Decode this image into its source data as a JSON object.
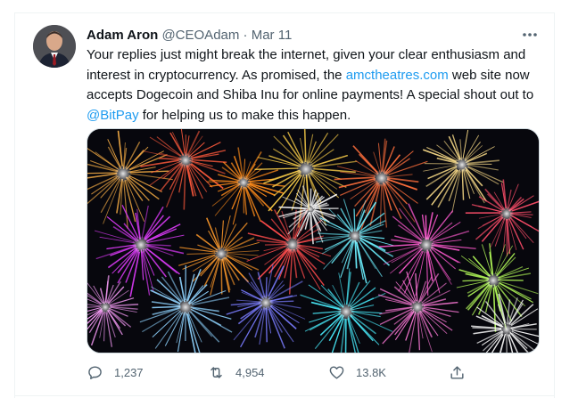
{
  "tweet": {
    "author_name": "Adam Aron",
    "handle": "@CEOAdam",
    "separator": "·",
    "date": "Mar 11",
    "text_part1": "Your replies just might break the internet, given your clear enthusiasm and interest in cryptocurrency. As promised, the ",
    "link_site": "amctheatres.com",
    "text_part2": " web site now accepts Dogecoin and Shiba Inu for online payments! A special shout out to ",
    "link_mention": "@BitPay",
    "text_part3": " for helping us to make this happen.",
    "media_description_icon": "fireworks-image"
  },
  "actions": {
    "reply_count": "1,237",
    "retweet_count": "4,954",
    "like_count": "13.8K"
  },
  "colors": {
    "link": "#1d9bf0",
    "secondary_text": "#536471",
    "border": "#eff3f4"
  }
}
